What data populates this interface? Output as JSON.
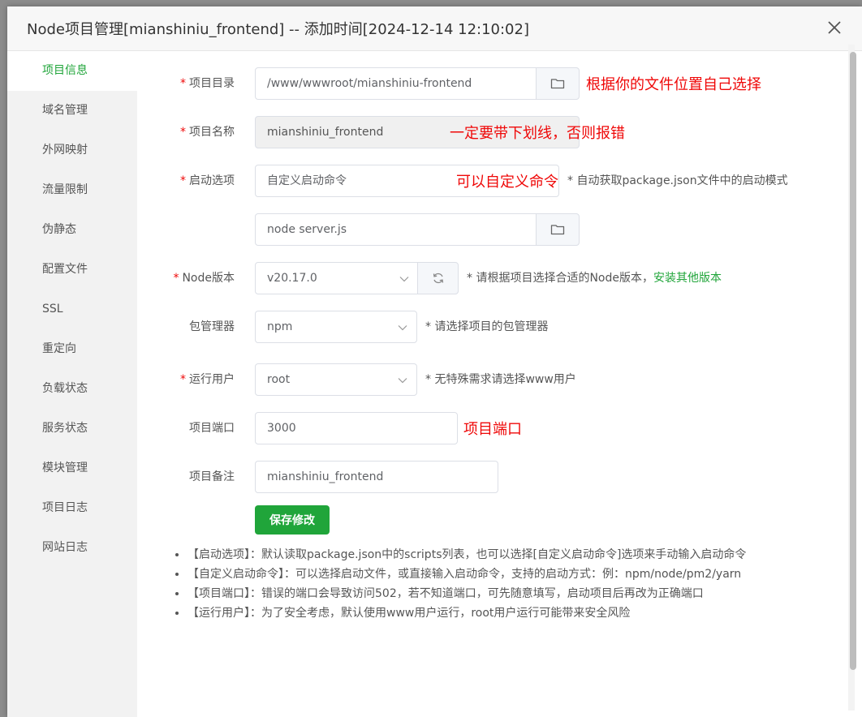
{
  "dialog": {
    "title": "Node项目管理[mianshiniu_frontend] -- 添加时间[2024-12-14 12:10:02]"
  },
  "sidebar": {
    "items": [
      {
        "label": "项目信息"
      },
      {
        "label": "域名管理"
      },
      {
        "label": "外网映射"
      },
      {
        "label": "流量限制"
      },
      {
        "label": "伪静态"
      },
      {
        "label": "配置文件"
      },
      {
        "label": "SSL"
      },
      {
        "label": "重定向"
      },
      {
        "label": "负载状态"
      },
      {
        "label": "服务状态"
      },
      {
        "label": "模块管理"
      },
      {
        "label": "项目日志"
      },
      {
        "label": "网站日志"
      }
    ],
    "active": "项目信息"
  },
  "form": {
    "required_mark": "*",
    "project_dir": {
      "label": "项目目录",
      "value": "/www/wwwroot/mianshiniu-frontend"
    },
    "project_name": {
      "label": "项目名称",
      "value": "mianshiniu_frontend"
    },
    "start_option": {
      "label": "启动选项",
      "value": "自定义启动命令",
      "hint": "* 自动获取package.json文件中的启动模式"
    },
    "start_command": {
      "value": "node server.js"
    },
    "node_version": {
      "label": "Node版本",
      "value": "v20.17.0",
      "hint": "* 请根据项目选择合适的Node版本，",
      "link": "安装其他版本"
    },
    "package_manager": {
      "label": "包管理器",
      "value": "npm",
      "hint": "* 请选择项目的包管理器"
    },
    "run_user": {
      "label": "运行用户",
      "value": "root",
      "hint": "* 无特殊需求请选择www用户"
    },
    "port": {
      "label": "项目端口",
      "value": "3000"
    },
    "remark": {
      "label": "项目备注",
      "value": "mianshiniu_frontend"
    },
    "save_label": "保存修改"
  },
  "annotations": {
    "dir": "根据你的文件位置自己选择",
    "name": "一定要带下划线，否则报错",
    "option": "可以自定义命令",
    "port": "项目端口"
  },
  "tips": [
    "【启动选项】：默认读取package.json中的scripts列表，也可以选择[自定义启动命令]选项来手动输入启动命令",
    "【自定义启动命令】：可以选择启动文件，或直接输入启动命令，支持的启动方式：例：npm/node/pm2/yarn",
    "【项目端口】：错误的端口会导致访问502，若不知道端口，可先随意填写，启动项目后再改为正确端口",
    "【运行用户】：为了安全考虑，默认使用www用户运行，root用户运行可能带来安全风险"
  ],
  "colors": {
    "accent": "#20a53a",
    "required": "#ef0808",
    "annotation": "#ef0808"
  },
  "icons": {
    "close": "close-icon",
    "folder": "folder-icon",
    "refresh": "refresh-icon",
    "chevron": "chevron-down-icon"
  }
}
